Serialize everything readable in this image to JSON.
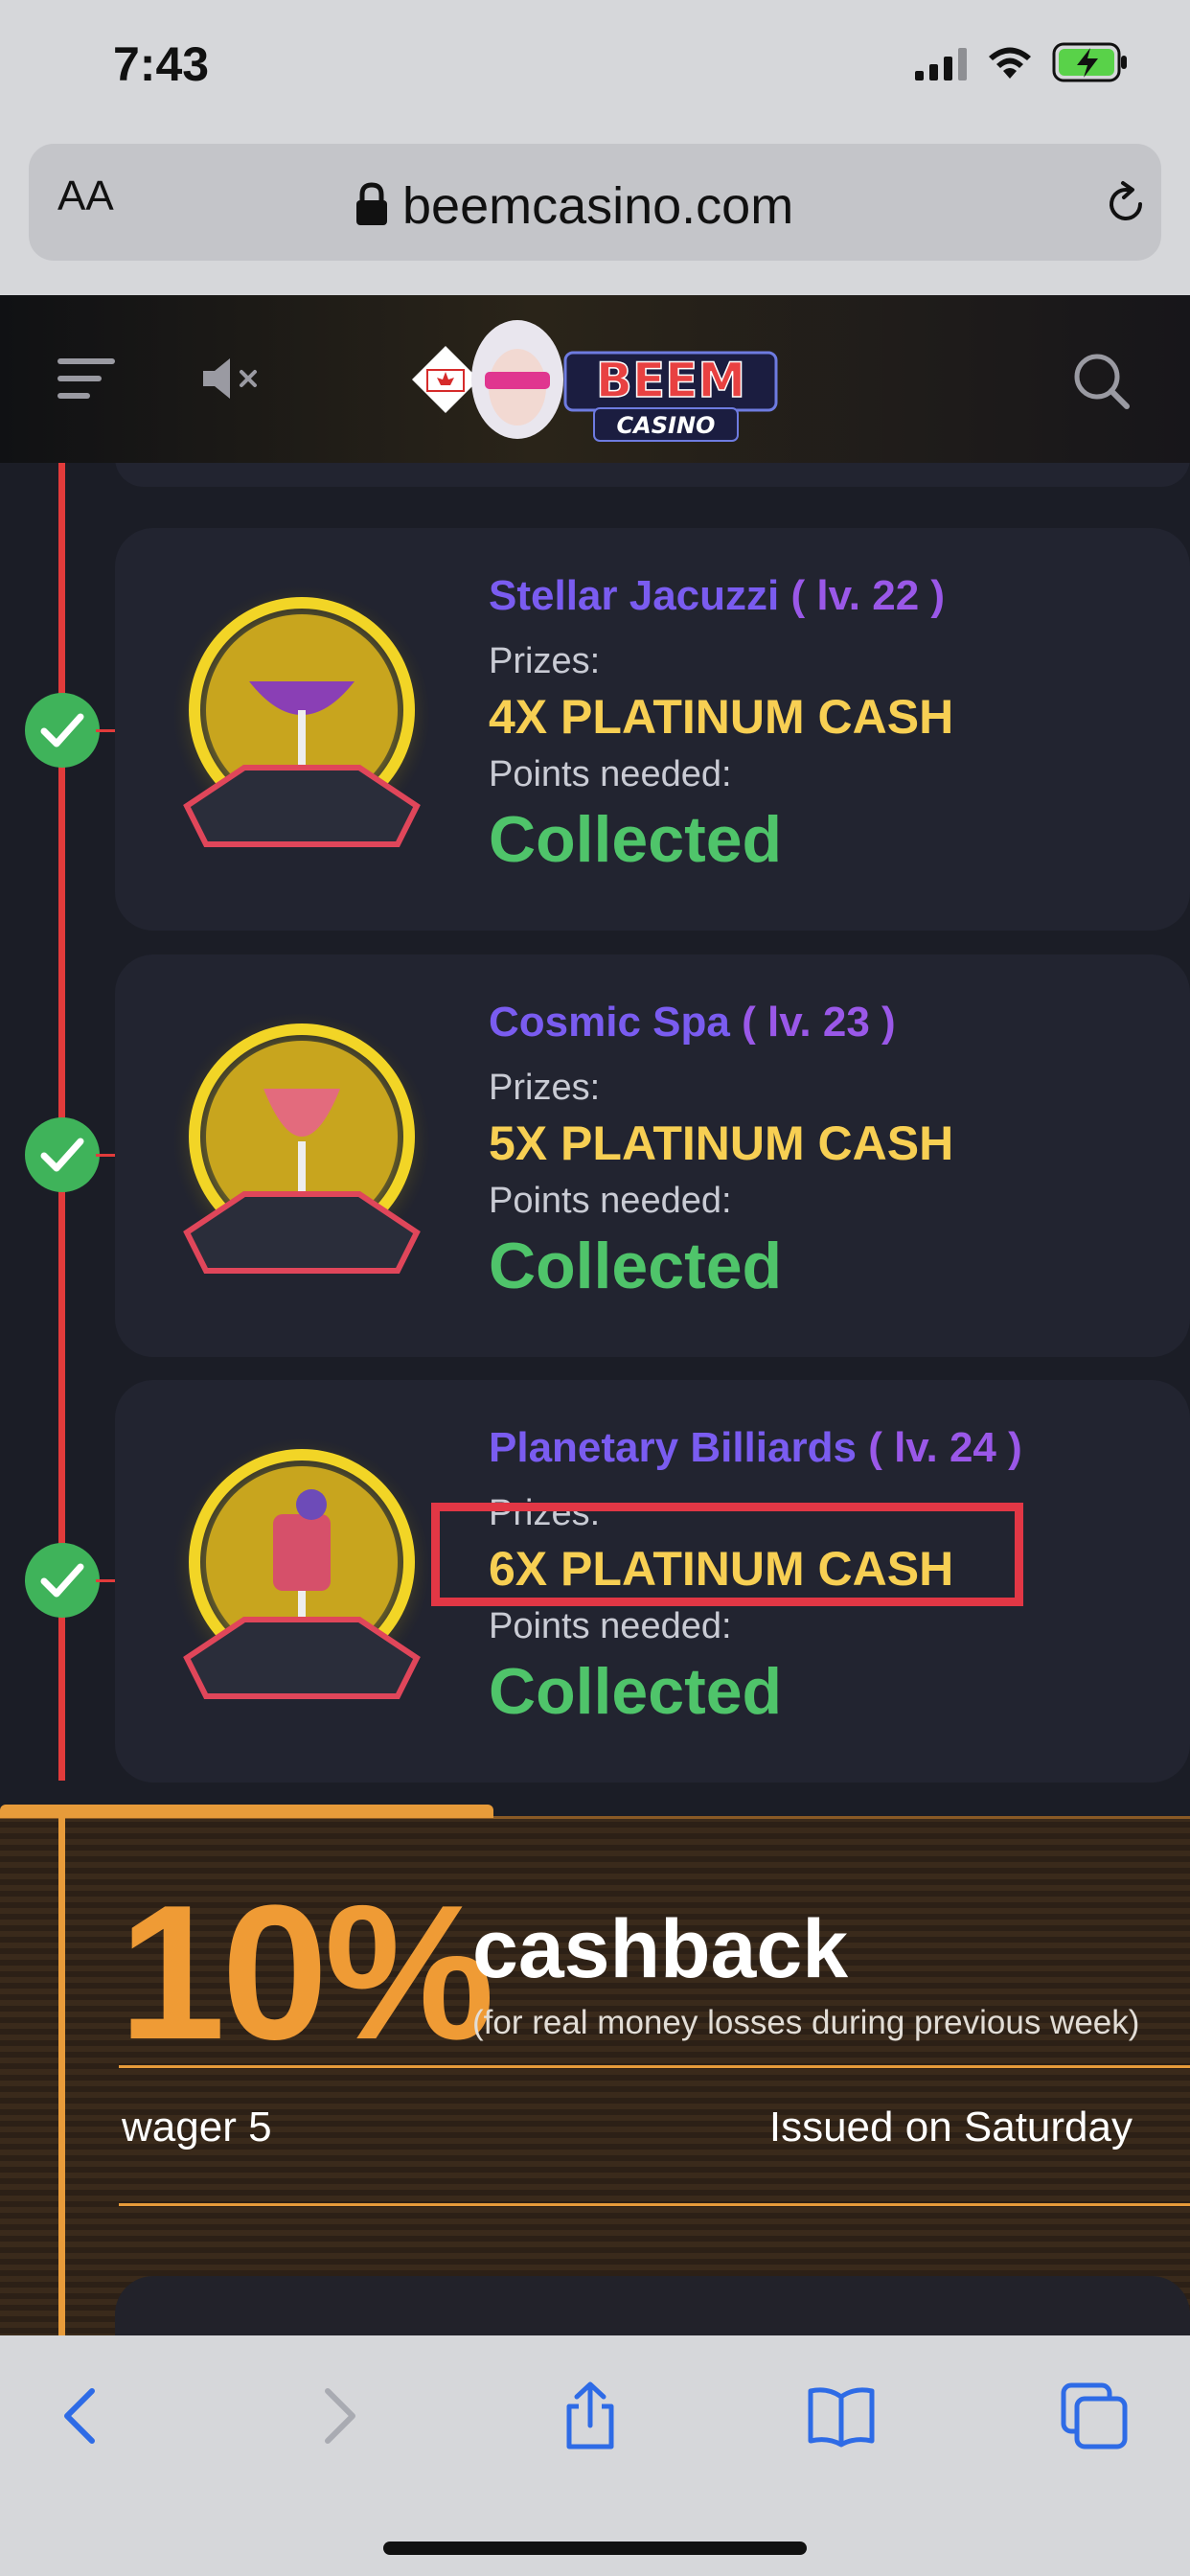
{
  "status_bar": {
    "time": "7:43"
  },
  "browser": {
    "text_size_label": "AA",
    "url": "beemcasino.com"
  },
  "header": {
    "logo_text": "BEEM",
    "logo_sub": "CASINO"
  },
  "levels": [
    {
      "name": "Stellar Jacuzzi",
      "level": "( lv. 22 )",
      "prizes_label": "Prizes:",
      "prize": "4X PLATINUM CASH",
      "points_label": "Points needed:",
      "status": "Collected"
    },
    {
      "name": "Cosmic Spa",
      "level": "( lv. 23 )",
      "prizes_label": "Prizes:",
      "prize": "5X PLATINUM CASH",
      "points_label": "Points needed:",
      "status": "Collected"
    },
    {
      "name": "Planetary Billiards",
      "level": "( lv. 24 )",
      "prizes_label": "Prizes:",
      "prize": "6X PLATINUM CASH",
      "points_label": "Points needed:",
      "status": "Collected"
    }
  ],
  "cashback": {
    "percent": "10%",
    "word": "cashback",
    "note": "(for real money losses during previous week)",
    "wager": "wager 5",
    "issued": "Issued on Saturday"
  },
  "colors": {
    "accent_red": "#e23b3b",
    "prize_gold": "#f7cf53",
    "collected_green": "#4fc46a",
    "level_purple": "#7a5cf0",
    "cashback_orange": "#ef9b35"
  }
}
